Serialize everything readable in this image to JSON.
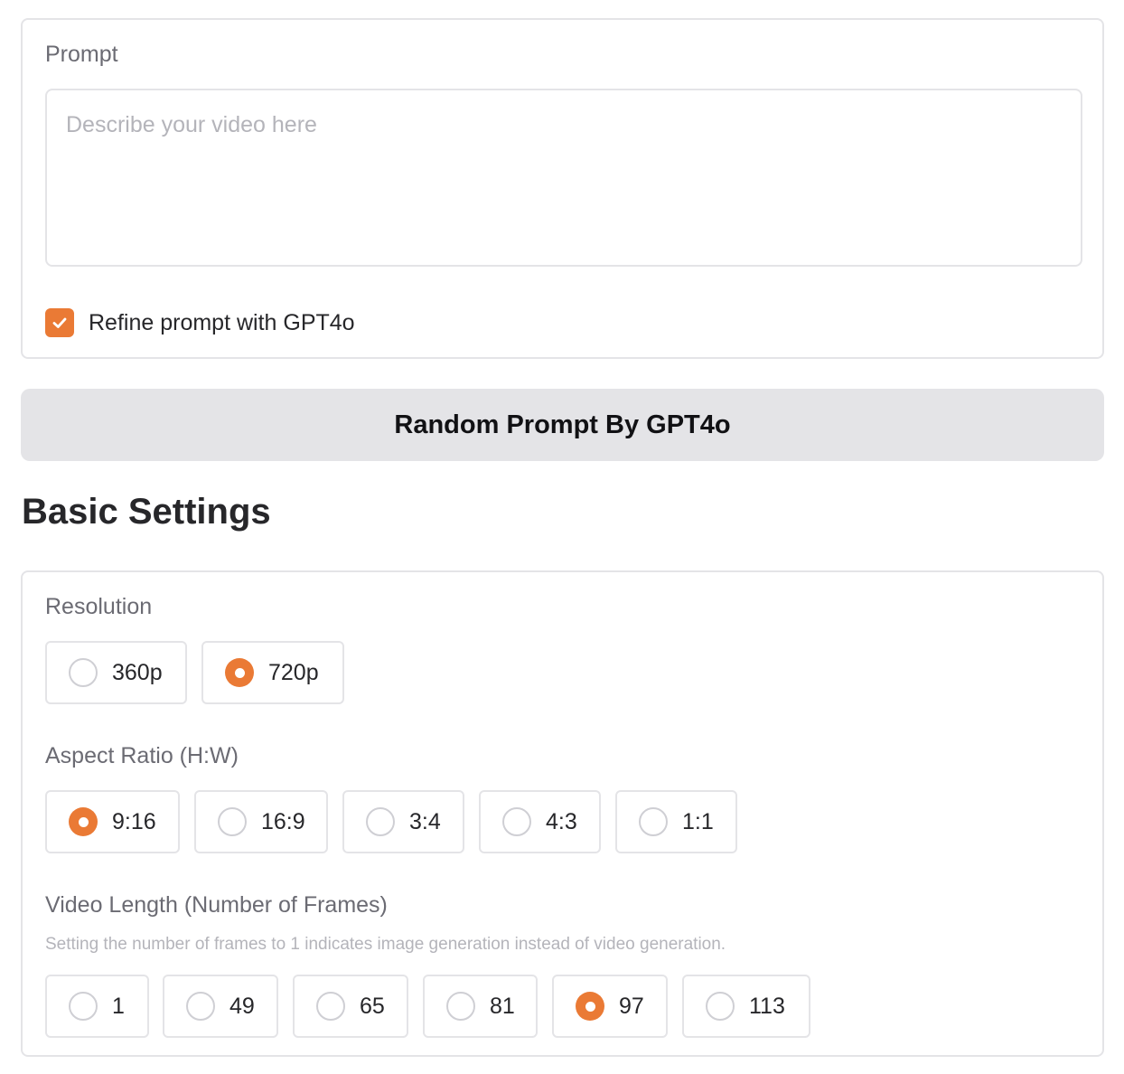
{
  "prompt": {
    "label": "Prompt",
    "placeholder": "Describe your video here",
    "value": "",
    "refine": {
      "label": "Refine prompt with GPT4o",
      "checked": true
    }
  },
  "random_button": {
    "label": "Random Prompt By GPT4o"
  },
  "basic_settings": {
    "title": "Basic Settings",
    "resolution": {
      "label": "Resolution",
      "selected": "720p",
      "options": [
        "360p",
        "720p"
      ]
    },
    "aspect_ratio": {
      "label": "Aspect Ratio (H:W)",
      "selected": "9:16",
      "options": [
        "9:16",
        "16:9",
        "3:4",
        "4:3",
        "1:1"
      ]
    },
    "video_length": {
      "label": "Video Length (Number of Frames)",
      "info": "Setting the number of frames to 1 indicates image generation instead of video generation.",
      "selected": "97",
      "options": [
        "1",
        "49",
        "65",
        "81",
        "97",
        "113"
      ]
    }
  },
  "colors": {
    "accent": "#ea7a35",
    "border": "#e4e4e7",
    "button_bg": "#e4e4e7",
    "label_text": "#6b6b73",
    "placeholder_text": "#b4b4ba"
  }
}
